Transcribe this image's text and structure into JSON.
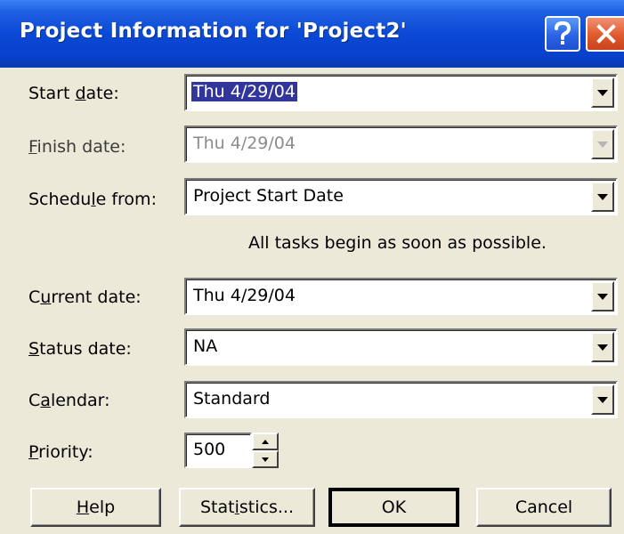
{
  "window": {
    "title": "Project Information for 'Project2'",
    "help_icon": "question-mark-icon",
    "close_icon": "close-icon"
  },
  "fields": {
    "start_date": {
      "label_pre": "Start ",
      "label_key": "d",
      "label_post": "ate:",
      "value": "Thu 4/29/04"
    },
    "finish_date": {
      "label_pre": "",
      "label_key": "F",
      "label_post": "inish date:",
      "value": "Thu 4/29/04"
    },
    "schedule_from": {
      "label_pre": "Schedu",
      "label_key": "l",
      "label_post": "e from:",
      "value": "Project Start Date"
    },
    "current_date": {
      "label_pre": "C",
      "label_key": "u",
      "label_post": "rrent date:",
      "value": "Thu 4/29/04"
    },
    "status_date": {
      "label_pre": "",
      "label_key": "S",
      "label_post": "tatus date:",
      "value": "NA"
    },
    "calendar": {
      "label_pre": "C",
      "label_key": "a",
      "label_post": "lendar:",
      "value": "Standard"
    },
    "priority": {
      "label_pre": "",
      "label_key": "P",
      "label_post": "riority:",
      "value": "500"
    }
  },
  "info_text": "All tasks begin as soon as possible.",
  "buttons": {
    "help": {
      "pre": "",
      "key": "H",
      "post": "elp"
    },
    "statistics": {
      "pre": "Stat",
      "key": "i",
      "post": "stics..."
    },
    "ok": "OK",
    "cancel": "Cancel"
  },
  "colors": {
    "titlebar": "#0a49d6",
    "dialog_bg": "#ece9d8",
    "selection": "#32369b"
  }
}
